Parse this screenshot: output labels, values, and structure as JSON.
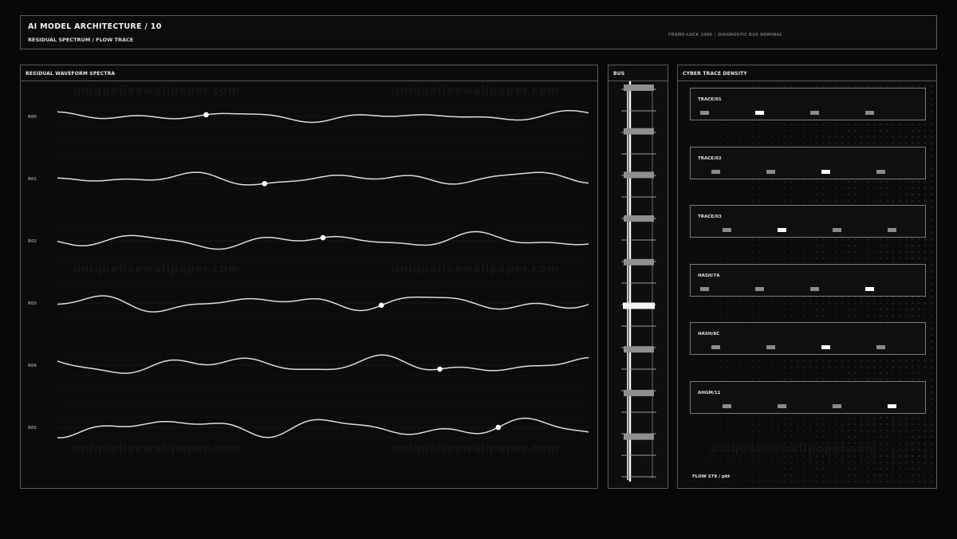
{
  "header": {
    "title": "AI MODEL ARCHITECTURE / 10",
    "subtitle": "RESIDUAL SPECTRUM / FLOW TRACE",
    "status": "FRAME-LOCK 1000 │ DIAGNOSTIC BUS NOMINAL"
  },
  "waveform_panel": {
    "title": "RESIDUAL WAVEFORM SPECTRA",
    "rows": [
      {
        "label": "R00",
        "seed": 1,
        "amp": 0.55,
        "marker_x": 0.28
      },
      {
        "label": "R01",
        "seed": 2,
        "amp": 0.75,
        "marker_x": 0.39
      },
      {
        "label": "R02",
        "seed": 3,
        "amp": 0.85,
        "marker_x": 0.5
      },
      {
        "label": "R03",
        "seed": 4,
        "amp": 0.95,
        "marker_x": 0.61
      },
      {
        "label": "R04",
        "seed": 5,
        "amp": 1.05,
        "marker_x": 0.72
      },
      {
        "label": "R05",
        "seed": 6,
        "amp": 1.15,
        "marker_x": 0.83
      }
    ]
  },
  "bus_panel": {
    "title": "BUS",
    "active_index": 5,
    "block_count": 9
  },
  "density_panel": {
    "title": "CYBER TRACE DENSITY",
    "traces": [
      {
        "label": "TRACE/01",
        "marks": [
          0,
          1,
          0,
          0
        ],
        "offset": 0
      },
      {
        "label": "TRACE/02",
        "marks": [
          0,
          0,
          1,
          0
        ],
        "offset": 1
      },
      {
        "label": "TRACE/03",
        "marks": [
          0,
          1,
          0,
          0
        ],
        "offset": 2
      },
      {
        "label": "HASH/7A",
        "marks": [
          0,
          0,
          0,
          1
        ],
        "offset": 0
      },
      {
        "label": "HASH/8C",
        "marks": [
          0,
          0,
          1,
          0
        ],
        "offset": 1
      },
      {
        "label": "AHGM/11",
        "marks": [
          0,
          0,
          0,
          1
        ],
        "offset": 2
      }
    ],
    "flow": "FLOW 279 / pkt"
  },
  "watermark": "uniquelivewallpaper.com",
  "colors": {
    "background": "#070807",
    "border": "#5a5c5a",
    "wave": "#f0f0f0",
    "accent": "#ffffff",
    "muted": "#8a8c8a"
  }
}
